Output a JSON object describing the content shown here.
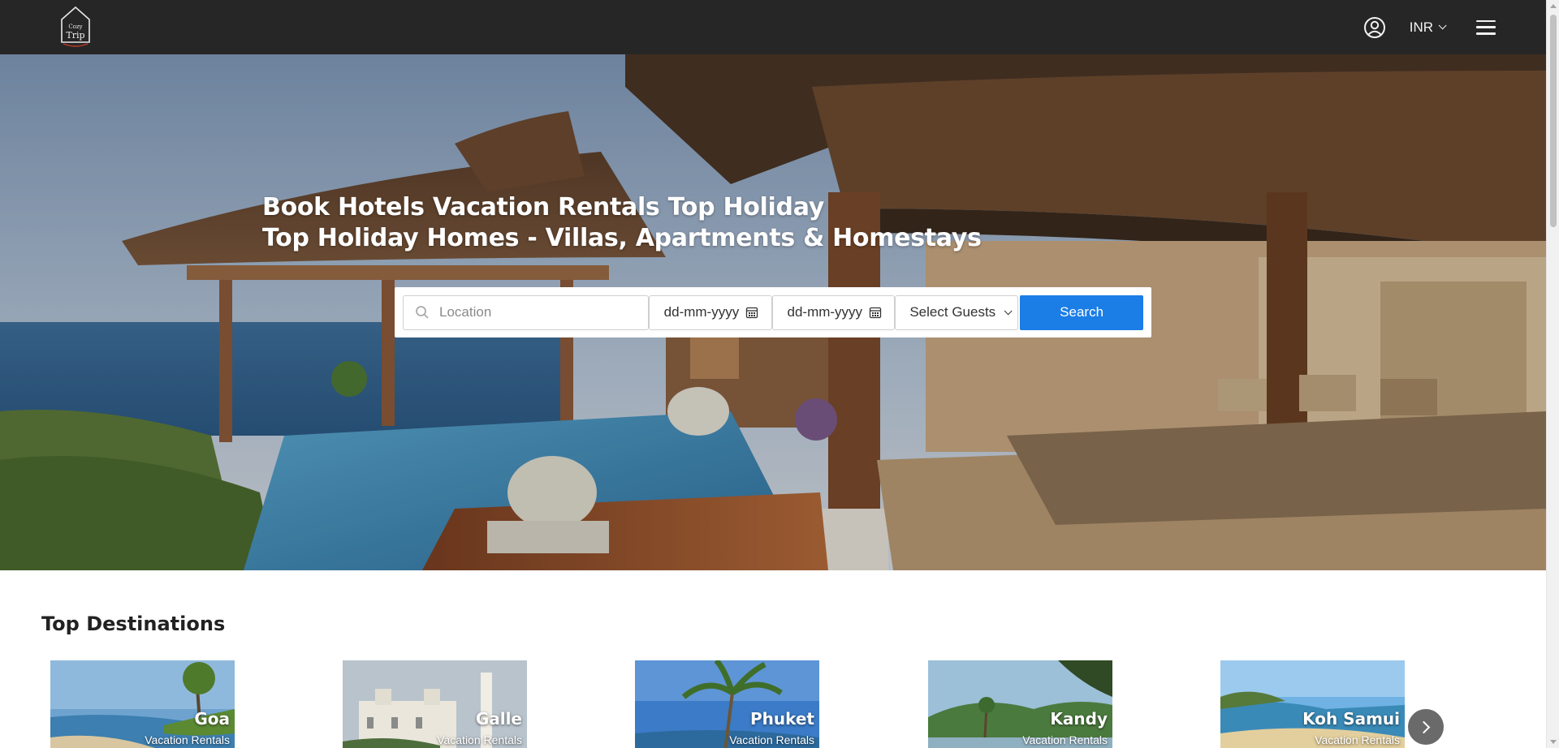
{
  "navbar": {
    "logo_top": "Cozy",
    "logo_bottom": "Trip",
    "currency": "INR"
  },
  "hero": {
    "title_line1": "Book Hotels Vacation Rentals Top Holiday",
    "title_line2": "Top Holiday Homes - Villas, Apartments & Homestays"
  },
  "search": {
    "location_placeholder": "Location",
    "checkin": "dd-mm-yyyy",
    "checkout": "dd-mm-yyyy",
    "guests": "Select Guests",
    "button": "Search"
  },
  "destinations": {
    "title": "Top Destinations",
    "items": [
      {
        "name": "Goa",
        "subtitle": "Vacation Rentals"
      },
      {
        "name": "Galle",
        "subtitle": "Vacation Rentals"
      },
      {
        "name": "Phuket",
        "subtitle": "Vacation Rentals"
      },
      {
        "name": "Kandy",
        "subtitle": "Vacation Rentals"
      },
      {
        "name": "Koh Samui",
        "subtitle": "Vacation Rentals"
      }
    ]
  },
  "colors": {
    "navbar": "#262626",
    "accent": "#1b7de6"
  }
}
